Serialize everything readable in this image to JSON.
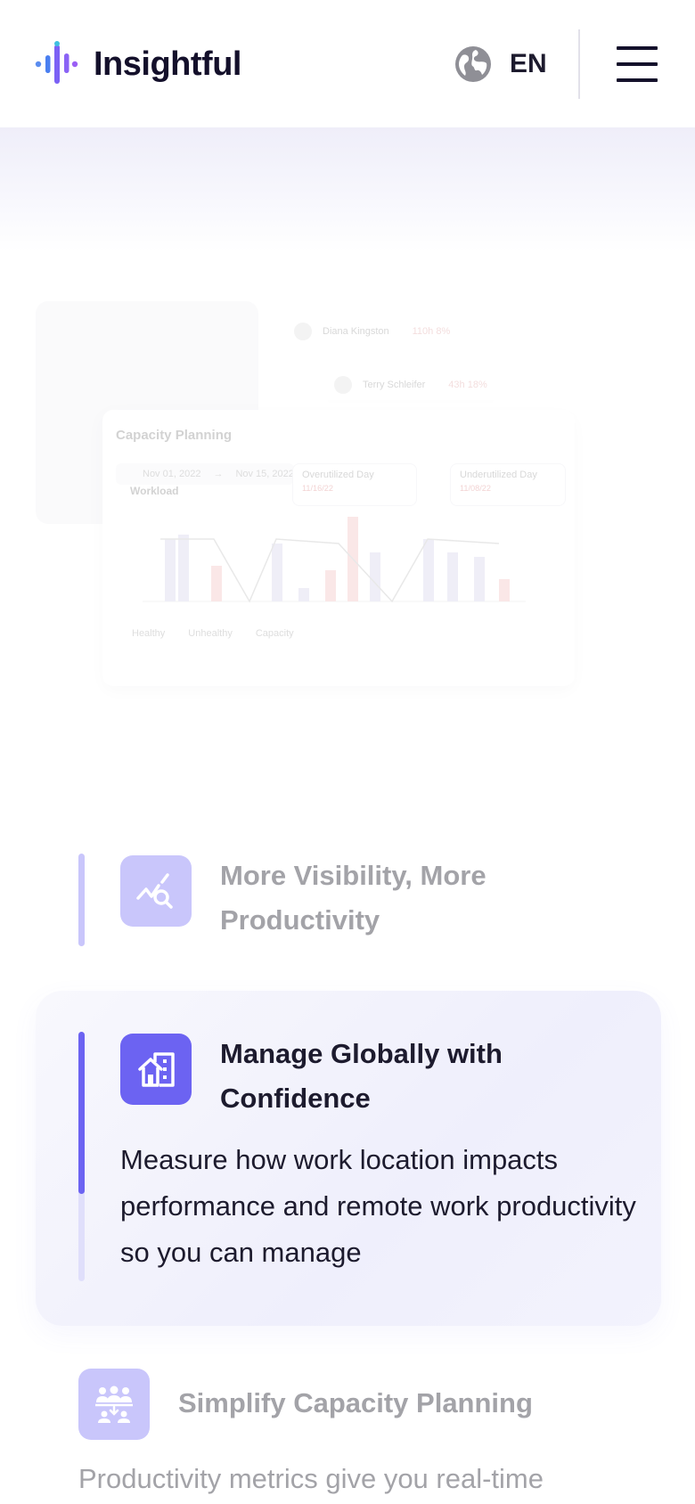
{
  "header": {
    "brand": "Insightful",
    "language": "EN",
    "menu_icon": "hamburger-icon",
    "globe_icon": "globe-icon"
  },
  "preview": {
    "title": "Capacity Planning",
    "date_from": "Nov 01, 2022",
    "date_to": "Nov 15, 2022",
    "people": [
      {
        "name": "Diana Kingston",
        "stat": "110h  8%"
      },
      {
        "name": "Terry Schleifer",
        "stat": "43h  18%"
      }
    ],
    "cards": [
      {
        "label": "Overutilized Day",
        "value": "11/16/22"
      },
      {
        "label": "Underutilized Day",
        "value": "11/08/22"
      }
    ],
    "chart_label": "Workload",
    "legend": [
      "Healthy",
      "Unhealthy",
      "Capacity"
    ]
  },
  "features": [
    {
      "title": "More Visibility, More Productivity",
      "state": "inactive",
      "icon": "chart-search-icon"
    },
    {
      "title": "Manage Globally with Confidence",
      "description": "Measure how work location impacts performance and remote work productivity so you can manage",
      "state": "active",
      "icon": "office-building-icon",
      "progress": 0.65
    },
    {
      "title": "Simplify Capacity Planning",
      "description": "Productivity metrics give you real-time",
      "state": "inactive",
      "icon": "team-group-icon"
    }
  ],
  "colors": {
    "accent": "#6c63f2",
    "accent_light": "#c9c6fb",
    "text_dark": "#1d1b2e",
    "text_muted": "#a3a3a8"
  }
}
